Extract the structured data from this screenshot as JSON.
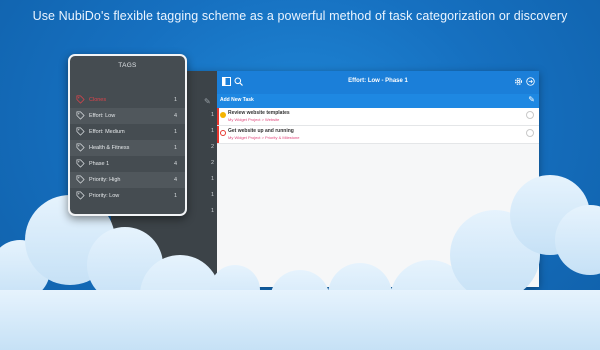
{
  "headline": "Use NubiDo's flexible tagging scheme as a powerful method of task categorization or discovery",
  "colors": {
    "accent": "#1b7fd9",
    "sidebar": "#3c4348",
    "tag_selected": "#e0434b",
    "task_flag": "#e6372f"
  },
  "sidebar": {
    "counts": [
      "1",
      "1",
      "2",
      "2",
      "1",
      "1",
      "1"
    ]
  },
  "topbar": {
    "title": "Effort: Low - Phase 1",
    "icons": [
      "sidebar-toggle-icon",
      "search-icon",
      "gear-icon",
      "share-icon"
    ]
  },
  "add_task": {
    "label": "Add New Task"
  },
  "tasks": [
    {
      "title": "Review website templates",
      "meta": "My Widget Project > Website",
      "check_color": "#f5b400"
    },
    {
      "title": "Get website up and running",
      "meta": "My Widget Project > Priority & Milestone",
      "check_color": "#ffffff"
    }
  ],
  "tags": {
    "header": "TAGS",
    "items": [
      {
        "name": "Clones",
        "count": "1",
        "selected": true
      },
      {
        "name": "Effort: Low",
        "count": "4",
        "selected": false
      },
      {
        "name": "Effort: Medium",
        "count": "1",
        "selected": false
      },
      {
        "name": "Health & Fitness",
        "count": "1",
        "selected": false
      },
      {
        "name": "Phase 1",
        "count": "4",
        "selected": false
      },
      {
        "name": "Priority: High",
        "count": "4",
        "selected": false
      },
      {
        "name": "Priority: Low",
        "count": "1",
        "selected": false
      }
    ]
  }
}
